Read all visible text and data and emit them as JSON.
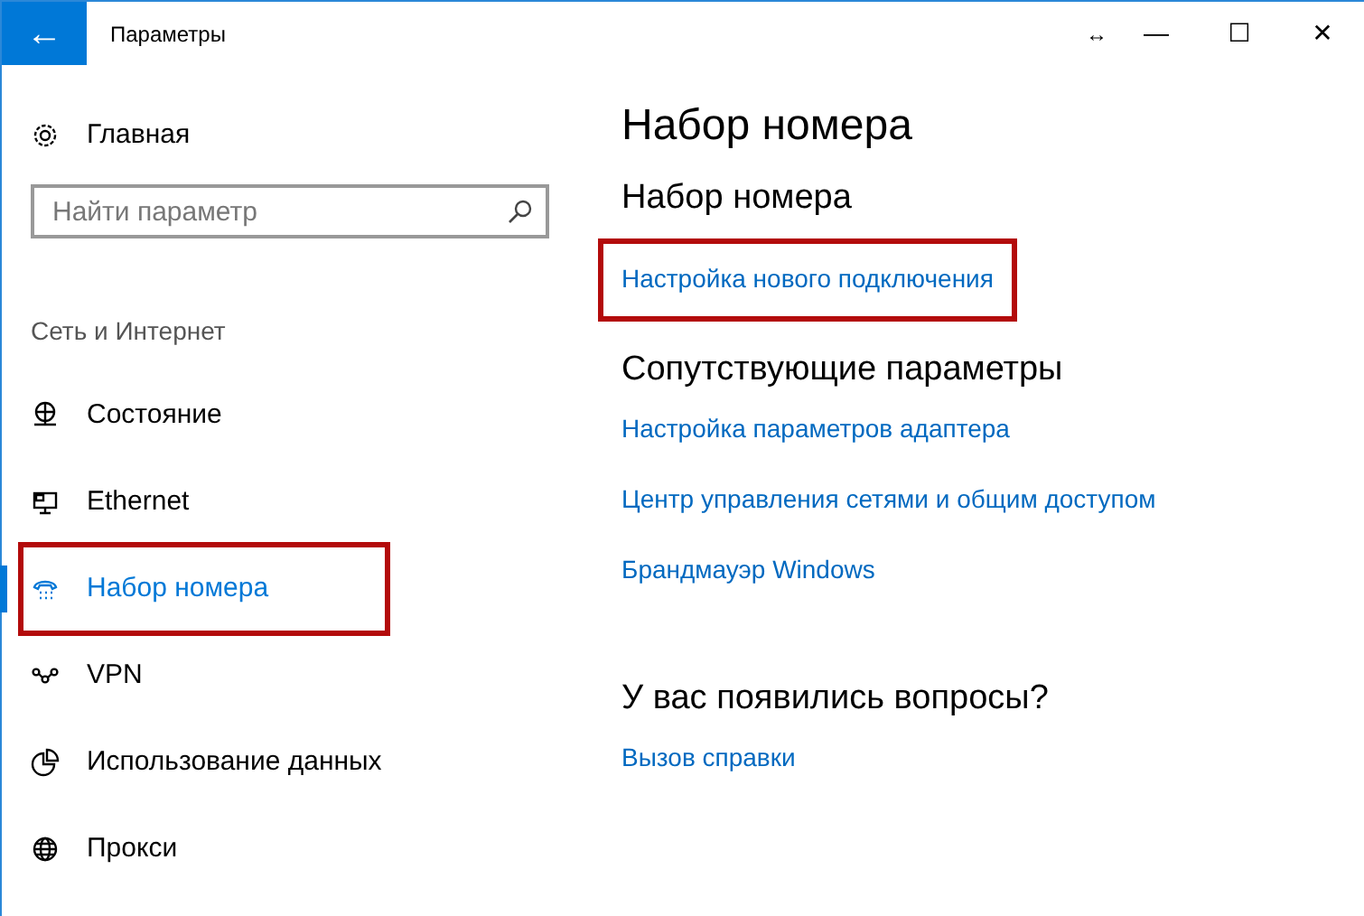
{
  "window": {
    "title": "Параметры",
    "back": "←",
    "controls": [
      "↔",
      "—",
      "☐",
      "✕"
    ]
  },
  "sidebar": {
    "home": "Главная",
    "search": {
      "placeholder": "Найти параметр"
    },
    "section": "Сеть и Интернет",
    "items": [
      {
        "label": "Состояние",
        "kind": "status",
        "selected": false,
        "highlighted": false
      },
      {
        "label": "Ethernet",
        "kind": "ethernet",
        "selected": false,
        "highlighted": false
      },
      {
        "label": "Набор номера",
        "kind": "dialup",
        "selected": true,
        "highlighted": true
      },
      {
        "label": "VPN",
        "kind": "vpn",
        "selected": false,
        "highlighted": false
      },
      {
        "label": "Использование данных",
        "kind": "data",
        "selected": false,
        "highlighted": false
      },
      {
        "label": "Прокси",
        "kind": "proxy",
        "selected": false,
        "highlighted": false
      }
    ]
  },
  "content": {
    "title": "Набор номера",
    "sections": [
      {
        "heading": "Набор номера",
        "links": [
          {
            "label": "Настройка нового подключения",
            "highlighted": true
          }
        ]
      },
      {
        "heading": "Сопутствующие параметры",
        "links": [
          {
            "label": "Настройка параметров адаптера",
            "highlighted": false
          },
          {
            "label": "Центр управления сетями и общим доступом",
            "highlighted": false
          },
          {
            "label": "Брандмауэр Windows",
            "highlighted": false
          }
        ]
      },
      {
        "heading": "У вас появились вопросы?",
        "links": [
          {
            "label": "Вызов справки",
            "highlighted": false
          }
        ]
      }
    ]
  }
}
